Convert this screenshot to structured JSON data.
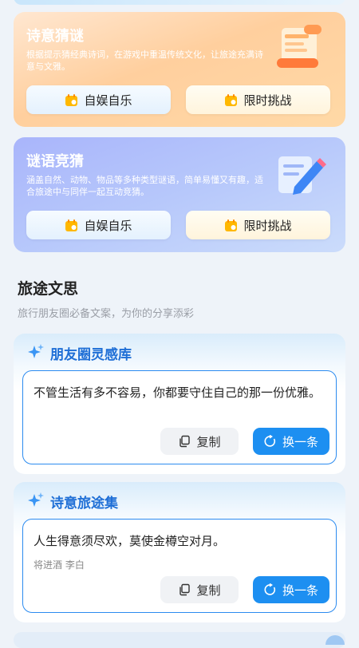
{
  "cards": [
    {
      "title": "诗意猜谜",
      "desc": "根据提示猜经典诗词，在游戏中重温传统文化，让旅途充满诗意与文雅。",
      "btn_left": "自娱自乐",
      "btn_right": "限时挑战",
      "illustration": "scroll-icon"
    },
    {
      "title": "谜语竞猜",
      "desc": "涵盖自然、动物、物品等多种类型谜语，简单易懂又有趣，适合旅途中与同伴一起互动竞猜。",
      "btn_left": "自娱自乐",
      "btn_right": "限时挑战",
      "illustration": "pencil-note-icon"
    }
  ],
  "section": {
    "title": "旅途文思",
    "subtitle": "旅行朋友圈必备文案，为你的分享添彩"
  },
  "quotes": [
    {
      "title": "朋友圈灵感库",
      "text": "不管生活有多不容易，你都要守住自己的那一份优雅。",
      "source": "",
      "copy_label": "复制",
      "refresh_label": "换一条"
    },
    {
      "title": "诗意旅途集",
      "text": "人生得意须尽欢，莫使金樽空对月。",
      "source": "将进酒 李白",
      "copy_label": "复制",
      "refresh_label": "换一条"
    }
  ],
  "colors": {
    "accent": "#1d8ff1",
    "quote_title": "#1f6fd6",
    "orange_card": "#ffcf9e",
    "purple_card": "#b7c8fb"
  }
}
